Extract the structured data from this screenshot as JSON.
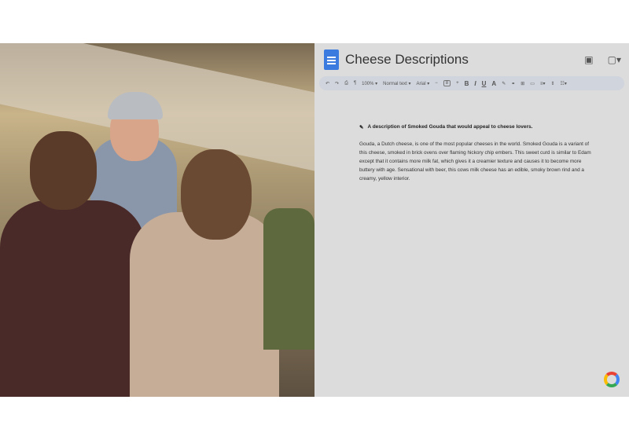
{
  "photo": {
    "description_alt": ""
  },
  "doc": {
    "title": "Cheese Descriptions",
    "toolbar": {
      "zoom": "100%",
      "style": "Normal text",
      "font": "Arial",
      "font_size": "8",
      "bold": "B",
      "italic": "I",
      "underline": "U",
      "text_color": "A"
    },
    "prompt": "A description of Smoked Gouda that would appeal to cheese lovers.",
    "body": "Gouda, a Dutch cheese, is one of the most popular cheeses in the world. Smoked Gouda is a variant of this cheese, smoked in brick ovens over flaming hickory chip embers. This sweet curd is similar to Edam except that it contains more milk fat, which gives it a creamier texture and causes it to become more buttery with age. Sensational with beer, this cows milk cheese has an edible, smoky brown rind and a creamy, yellow interior."
  }
}
